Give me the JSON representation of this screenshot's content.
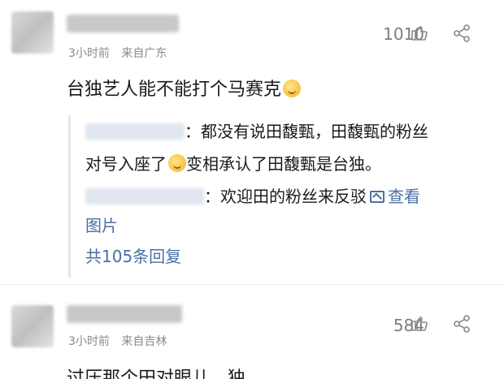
{
  "comments": [
    {
      "time": "3小时前",
      "location": "来自广东",
      "likes": "1010",
      "text": "台独艺人能不能打个马赛克",
      "replies": [
        {
          "text_before_emoji": "：都没有说田馥甄，田馥甄的粉丝",
          "text_line2_a": "对号入座了",
          "text_line2_b": "变相承认了田馥甄是台独。"
        },
        {
          "text": "：欢迎田的粉丝来反驳",
          "link_a": "查看",
          "link_b": "图片"
        }
      ],
      "total_replies": "共105条回复"
    },
    {
      "time": "3小时前",
      "location": "来自吉林",
      "likes": "584",
      "text": "过压那个田对眼儿，独"
    }
  ],
  "icons": {
    "like": "thumbs-up-icon",
    "share": "share-icon",
    "emoji": "laughing-emoji-icon",
    "picture": "picture-icon"
  },
  "colors": {
    "link": "#4a6fa5",
    "meta": "#8a8a8a",
    "text": "#1a1a1a"
  }
}
